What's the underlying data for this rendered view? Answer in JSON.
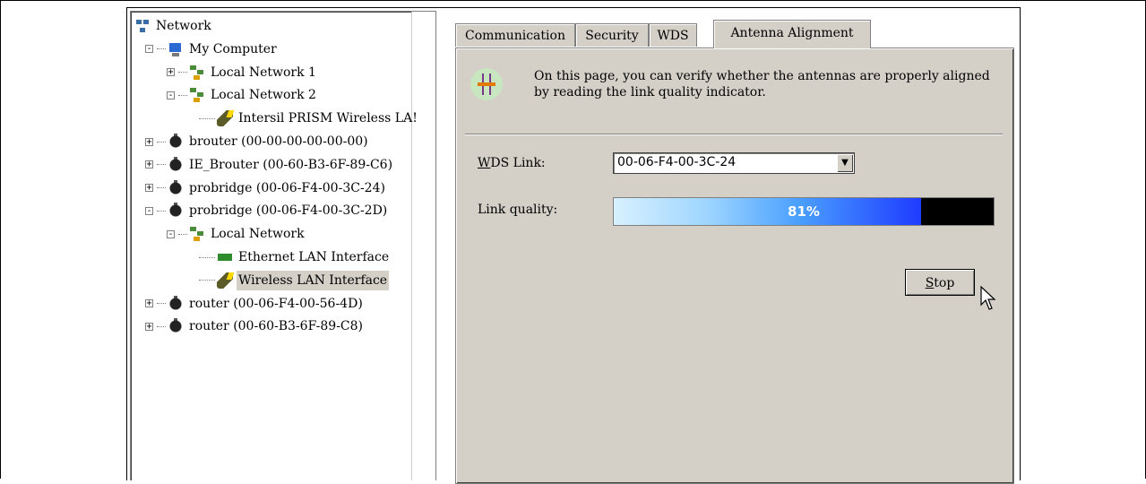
{
  "tree": {
    "items": [
      {
        "label": "Network",
        "icon": "network-icon",
        "expander": ""
      },
      {
        "label": "My Computer",
        "icon": "computer-icon",
        "expander": "−"
      },
      {
        "label": "Local Network 1",
        "icon": "local-network-icon",
        "expander": "+"
      },
      {
        "label": "Local Network 2",
        "icon": "local-network-icon",
        "expander": "−"
      },
      {
        "label": "Intersil PRISM  Wireless LA!",
        "icon": "wireless-card-icon",
        "expander": ""
      },
      {
        "label": "brouter (00-00-00-00-00-00)",
        "icon": "router-icon",
        "expander": "+"
      },
      {
        "label": "IE_Brouter (00-60-B3-6F-89-C6)",
        "icon": "router-icon",
        "expander": "+"
      },
      {
        "label": "probridge (00-06-F4-00-3C-24)",
        "icon": "router-icon",
        "expander": "+"
      },
      {
        "label": "probridge (00-06-F4-00-3C-2D)",
        "icon": "router-icon",
        "expander": "−"
      },
      {
        "label": "Local Network",
        "icon": "local-network-icon",
        "expander": "−"
      },
      {
        "label": "Ethernet LAN Interface",
        "icon": "ethernet-card-icon",
        "expander": ""
      },
      {
        "label": "Wireless LAN Interface",
        "icon": "wireless-card-icon",
        "expander": ""
      },
      {
        "label": "router (00-06-F4-00-56-4D)",
        "icon": "router-icon",
        "expander": "+"
      },
      {
        "label": "router (00-60-B3-6F-89-C8)",
        "icon": "router-icon",
        "expander": "+"
      }
    ],
    "selected": "Wireless LAN Interface"
  },
  "tabs": [
    {
      "label": "Communication"
    },
    {
      "label": "Security"
    },
    {
      "label": "WDS"
    },
    {
      "label": "Antenna Alignment"
    }
  ],
  "active_tab": "Antenna Alignment",
  "panel": {
    "info_line1": "On this page, you can verify whether the antennas are properly aligned",
    "info_line2": "by reading the link quality indicator.",
    "wds_label": "WDS Link:",
    "wds_value": "00-06-F4-00-3C-24",
    "link_quality_label": "Link quality:",
    "link_quality_percent": 81,
    "link_quality_text": "81%",
    "stop_button": "Stop"
  },
  "colors": {
    "panel_bg": "#d4d0c8",
    "bar_fill_end": "#1f3bff",
    "selection": "#d4d0c8"
  }
}
